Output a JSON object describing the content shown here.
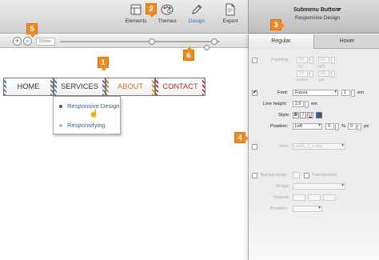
{
  "toolbar": {
    "items": [
      {
        "label": "Elements",
        "icon": "elements-icon"
      },
      {
        "label": "Themes",
        "icon": "palette-icon"
      },
      {
        "label": "Design",
        "icon": "pencil-icon"
      },
      {
        "label": "Export",
        "icon": "export-icon"
      }
    ],
    "active": "Design",
    "active_color": "#2d6fd1"
  },
  "inspector": {
    "title": "Submenu Button",
    "subtitle": "Responsive Design",
    "tabs": [
      "Regular",
      "Hover"
    ],
    "selected_tab": "Regular",
    "padding": {
      "label": "Padding:",
      "values": [
        "15",
        "15",
        "15",
        "15"
      ],
      "sublabels": [
        "top",
        "right",
        "bottom",
        "left"
      ]
    },
    "font": {
      "label": "Font:",
      "family": "Futura",
      "size": "1",
      "size_unit": "em",
      "line_height_label": "Line height:",
      "line_height": "2.5",
      "line_height_unit": "em",
      "style_label": "Style:",
      "style_buttons": [
        "B",
        "I",
        "U"
      ],
      "color": "#305e8c",
      "position_label": "Position:",
      "position": "Left",
      "pos_x": "0",
      "pos_x_unit": "%",
      "pos_y": "0",
      "pos_y_unit": "px"
    },
    "icon": {
      "label": "Icon:",
      "value": "radio_1_s.png"
    },
    "background": {
      "label": "Background:",
      "transparent_label": "Transparent",
      "image_label": "Image:",
      "repeat_label": "Repeat:",
      "position_label": "Position:"
    }
  },
  "zoom": {
    "value": "50kbx"
  },
  "canvas": {
    "nav": [
      "HOME",
      "SERVICES",
      "ABOUT",
      "CONTACT"
    ],
    "submenu": [
      "Responsive Design",
      "Responsifying"
    ]
  },
  "callouts": [
    "1",
    "2",
    "3",
    "4",
    "5",
    "6"
  ],
  "colors": {
    "callout": "#f08a20",
    "nav_about": "#c77a24",
    "nav_contact": "#b52a2a",
    "submenu_text": "#3a5e88"
  }
}
